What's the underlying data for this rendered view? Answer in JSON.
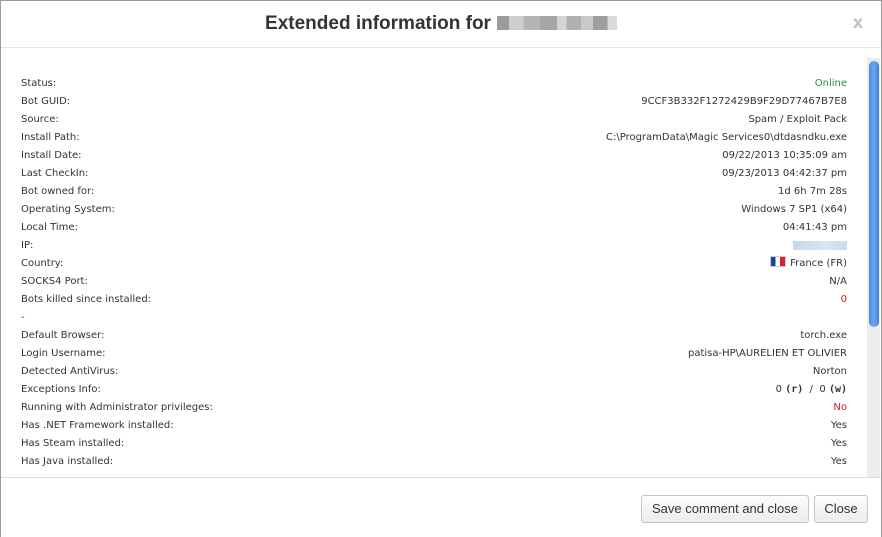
{
  "dialog": {
    "title": "Extended information for",
    "close_glyph": "x"
  },
  "rows": [
    {
      "label": "Status:",
      "value": "Online"
    },
    {
      "label": "Bot GUID:",
      "value": "9CCF3B332F1272429B9F29D77467B7E8"
    },
    {
      "label": "Source:",
      "value": "Spam / Exploit Pack"
    },
    {
      "label": "Install Path:",
      "value": "C:\\ProgramData\\Magic Services0\\dtdasndku.exe"
    },
    {
      "label": "Install Date:",
      "value": "09/22/2013 10:35:09 am"
    },
    {
      "label": "Last CheckIn:",
      "value": "09/23/2013 04:42:37 pm"
    },
    {
      "label": "Bot owned for:",
      "value": "1d 6h 7m 28s"
    },
    {
      "label": "Operating System:",
      "value": "Windows 7 SP1 (x64)"
    },
    {
      "label": "Local Time:",
      "value": "04:41:43 pm"
    },
    {
      "label": "IP:",
      "value": ""
    },
    {
      "label": "Country:",
      "value": "France (FR)"
    },
    {
      "label": "SOCKS4 Port:",
      "value": "N/A"
    },
    {
      "label": "Bots killed since installed:",
      "value": "0"
    },
    {
      "label": "-",
      "value": ""
    },
    {
      "label": "Default Browser:",
      "value": "torch.exe"
    },
    {
      "label": "Login Username:",
      "value": "patisa-HP\\AURELIEN ET OLIVIER"
    },
    {
      "label": "Detected AntiVirus:",
      "value": "Norton"
    },
    {
      "label": "Exceptions Info:",
      "value": ""
    },
    {
      "label": "Running with Administrator privileges:",
      "value": "No"
    },
    {
      "label": "Has .NET Framework installed:",
      "value": "Yes"
    },
    {
      "label": "Has Steam installed:",
      "value": "Yes"
    },
    {
      "label": "Has Java installed:",
      "value": "Yes"
    }
  ],
  "exceptions": {
    "r_count": "0",
    "r_tag": "(r)",
    "separator": "/",
    "w_count": "0",
    "w_tag": "(w)"
  },
  "colors": {
    "online": "#2e8b2e",
    "alert": "#cc2222"
  },
  "icons": {
    "country_flag": "flag-france-icon"
  },
  "footer": {
    "save_label": "Save comment and close",
    "close_label": "Close"
  }
}
